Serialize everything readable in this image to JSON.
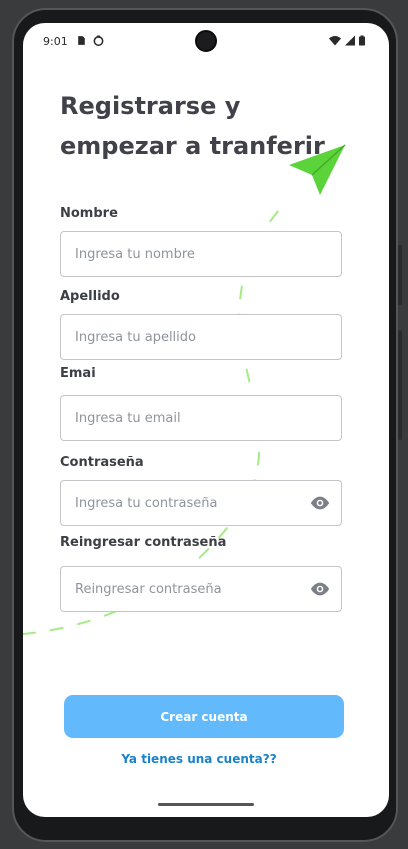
{
  "status": {
    "time": "9:01",
    "icons_left": [
      "sim-icon",
      "face-icon"
    ],
    "icons_right": [
      "wifi-icon",
      "signal-icon",
      "battery-icon"
    ]
  },
  "title": {
    "line1": "Registrarse y",
    "line2": "empezar a tranferir"
  },
  "form": {
    "nombre": {
      "label": "Nombre",
      "placeholder": "Ingresa tu nombre"
    },
    "apellido": {
      "label": "Apellido",
      "placeholder": "Ingresa tu apellido"
    },
    "email": {
      "label": "Emai",
      "placeholder": "Ingresa tu email"
    },
    "password": {
      "label": "Contraseña",
      "placeholder": "Ingresa tu contraseña"
    },
    "password_repeat": {
      "label": "Reingresar contraseña",
      "placeholder": "Reingresar contraseña"
    }
  },
  "actions": {
    "submit_label": "Crear cuenta",
    "login_link": "Ya tienes una cuenta??"
  },
  "colors": {
    "accent": "#62b9fb",
    "link": "#1a83c9",
    "plane": "#5bd33a",
    "dashes": "#a6ec86"
  }
}
